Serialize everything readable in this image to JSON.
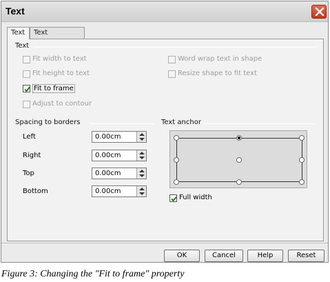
{
  "dialog": {
    "title": "Text",
    "tabs": [
      {
        "label": "Text",
        "active": true
      },
      {
        "label": "Text Animation",
        "active": false
      }
    ],
    "text_section": {
      "label": "Text",
      "checkboxes": [
        {
          "label": "Fit width to text",
          "checked": false,
          "enabled": false
        },
        {
          "label": "Word wrap text in shape",
          "checked": false,
          "enabled": false
        },
        {
          "label": "Fit height to text",
          "checked": false,
          "enabled": false
        },
        {
          "label": "Resize shape to fit text",
          "checked": false,
          "enabled": false
        },
        {
          "label": "Fit to frame",
          "checked": true,
          "enabled": true
        },
        {
          "label": "Adjust to contour",
          "checked": false,
          "enabled": false
        }
      ]
    },
    "spacing": {
      "label": "Spacing to borders",
      "fields": [
        {
          "label": "Left",
          "value": "0.00cm"
        },
        {
          "label": "Right",
          "value": "0.00cm"
        },
        {
          "label": "Top",
          "value": "0.00cm"
        },
        {
          "label": "Bottom",
          "value": "0.00cm"
        }
      ]
    },
    "anchor": {
      "label": "Text anchor",
      "selected": "top-center",
      "full_width_label": "Full width",
      "full_width_checked": true
    },
    "buttons": {
      "ok": "OK",
      "cancel": "Cancel",
      "help": "Help",
      "reset": "Reset"
    }
  },
  "caption": "Figure 3: Changing the \"Fit to frame\" property",
  "icons": {
    "close": "close-x-icon",
    "check": "checkmark-icon",
    "spin": "spin-arrows-icon"
  },
  "colors": {
    "close_button": "#c2361e",
    "dialog_bg": "#ebebeb",
    "anchor_bg": "#dcdcdc"
  }
}
